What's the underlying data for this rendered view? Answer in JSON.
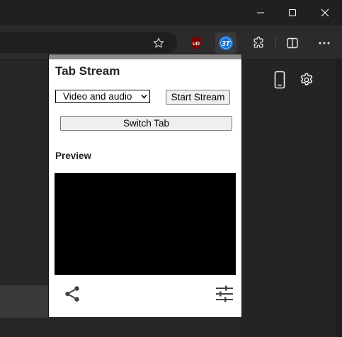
{
  "popup": {
    "title": "Tab Stream",
    "media_select": {
      "selected": "Video and audio"
    },
    "start_label": "Start Stream",
    "switch_label": "Switch Tab",
    "preview_label": "Preview"
  },
  "extension_badges": {
    "ublock": "uD",
    "tab_stream": "3T"
  },
  "icons": {
    "minimize": "minimize-icon",
    "maximize": "maximize-icon",
    "close": "close-icon",
    "favorite": "star-icon",
    "extensions": "puzzle-icon",
    "split_screen": "split-screen-icon",
    "menu": "more-icon",
    "device": "phone-icon",
    "settings": "gear-icon",
    "share": "share-icon",
    "tune": "sliders-icon"
  },
  "colors": {
    "chrome_dark": "#202020",
    "ublock_red": "#800000",
    "tab_stream_blue": "#1a6fd0"
  }
}
